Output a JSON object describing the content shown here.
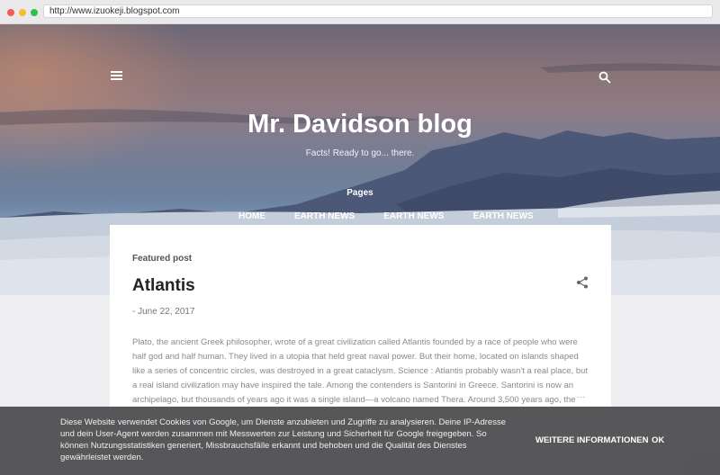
{
  "browser": {
    "url": "http://www.izuokeji.blogspot.com"
  },
  "header": {
    "title": "Mr. Davidson blog",
    "description": "Facts! Ready to go... there.",
    "pages_label": "Pages",
    "tabs": [
      {
        "label": "HOME",
        "active": true
      },
      {
        "label": "EARTH NEWS",
        "active": false
      },
      {
        "label": "EARTH NEWS",
        "active": false
      },
      {
        "label": "EARTH NEWS",
        "active": false
      }
    ]
  },
  "post": {
    "section_label": "Featured post",
    "title": "Atlantis",
    "date": "- June 22, 2017",
    "body": "Plato, the ancient Greek philosopher, wrote of a great civilization called Atlantis founded by a race of people who were half god and half human. They lived in a utopia that held great naval power. But their home, located on islands shaped like a series of concentric circles, was destroyed in a great cataclysm. Science : Atlantis probably wasn't a real place, but a real island civilization may have inspired the tale. Among the contenders is Santorini in Greece. Santorini is now an archipelago, but thousands of years ago it was a single island—a volcano named Thera. Around 3,500 years ago, the",
    "more": "…"
  },
  "cookie_banner": {
    "text": "Diese Website verwendet Cookies von Google, um Dienste anzubieten und Zugriffe zu analysieren. Deine IP-Adresse und dein User-Agent werden zusammen mit Messwerten zur Leistung und Sicherheit für Google freigegeben. So können Nutzungsstatistiken generiert, Missbrauchsfälle erkannt und behoben und die Qualität des Dienstes gewährleistet werden.",
    "more_label": "WEITERE INFORMATIONEN",
    "ok_label": "OK"
  },
  "icons": {
    "menu": "hamburger-menu-icon",
    "search": "search-icon",
    "share": "share-icon"
  }
}
